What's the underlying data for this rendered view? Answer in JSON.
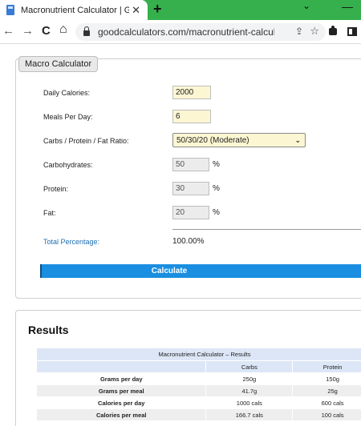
{
  "browser": {
    "tab_title": "Macronutrient Calculator | Good",
    "tab_close": "✕",
    "new_tab": "+",
    "url": "goodcalculators.com/macronutrient-calculat...",
    "back": "←",
    "forward": "→",
    "reload": "C",
    "home": "⌂",
    "chevron": "⌄",
    "minimize": "—"
  },
  "calculator": {
    "legend": "Macro Calculator",
    "fields": {
      "daily_calories": {
        "label": "Daily Calories:",
        "value": "2000"
      },
      "meals_per_day": {
        "label": "Meals Per Day:",
        "value": "6"
      },
      "ratio": {
        "label": "Carbs / Protein / Fat Ratio:",
        "value": "50/30/20 (Moderate)"
      },
      "carbohydrates": {
        "label": "Carbohydrates:",
        "value": "50",
        "unit": "%"
      },
      "protein": {
        "label": "Protein:",
        "value": "30",
        "unit": "%"
      },
      "fat": {
        "label": "Fat:",
        "value": "20",
        "unit": "%"
      }
    },
    "total_label": "Total Percentage:",
    "total_value": "100.00%",
    "button_label": "Calculate"
  },
  "results": {
    "title": "Results",
    "table_caption": "Macronutrient Calculator – Results",
    "columns": [
      "",
      "Carbs",
      "Protein"
    ],
    "rows": [
      {
        "label": "Grams per day",
        "carbs": "250g",
        "protein": "150g"
      },
      {
        "label": "Grams per meal",
        "carbs": "41.7g",
        "protein": "25g"
      },
      {
        "label": "Calories per day",
        "carbs": "1000 cals",
        "protein": "600 cals"
      },
      {
        "label": "Calories per meal",
        "carbs": "166.7 cals",
        "protein": "100 cals"
      }
    ]
  },
  "colors": {
    "tabbar": "#35b04c",
    "input_bg": "#fdf6d3",
    "button": "#1a8ee0",
    "link_text": "#1f6fb2"
  }
}
